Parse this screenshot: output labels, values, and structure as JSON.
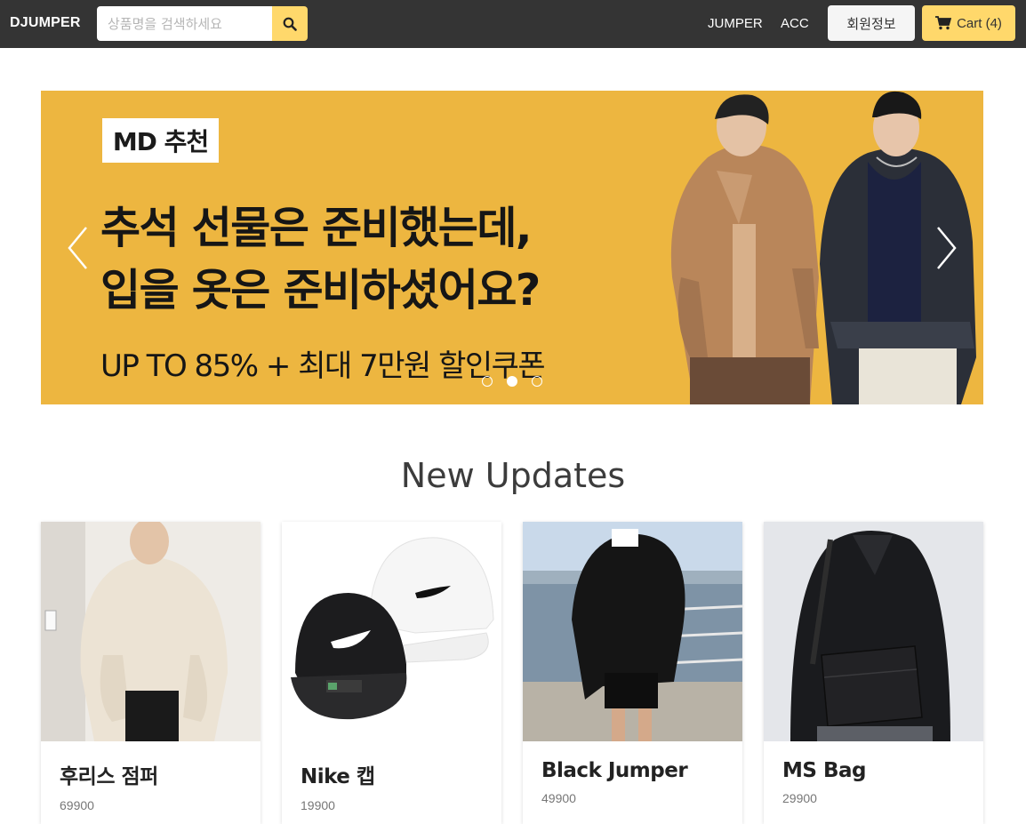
{
  "navbar": {
    "brand": "DJUMPER",
    "search_placeholder": "상품명을 검색하세요",
    "links": [
      "JUMPER",
      "ACC"
    ],
    "member_label": "회원정보",
    "cart_label": "Cart (4)"
  },
  "carousel": {
    "badge": "MD 추천",
    "headline_line1": "추석 선물은 준비했는데,",
    "headline_line2": "입을 옷은 준비하셨어요?",
    "subline": "UP TO 85% + 최대 7만원 할인쿠폰",
    "slide_count": 3,
    "active_index": 1,
    "background_color": "#edb640"
  },
  "section": {
    "title": "New Updates"
  },
  "products": [
    {
      "name": "후리스 점퍼",
      "price": "69900"
    },
    {
      "name": "Nike 캡",
      "price": "19900"
    },
    {
      "name": "Black Jumper",
      "price": "49900"
    },
    {
      "name": "MS Bag",
      "price": "29900"
    }
  ],
  "colors": {
    "navbar": "#343434",
    "accent": "#ffd86b"
  }
}
